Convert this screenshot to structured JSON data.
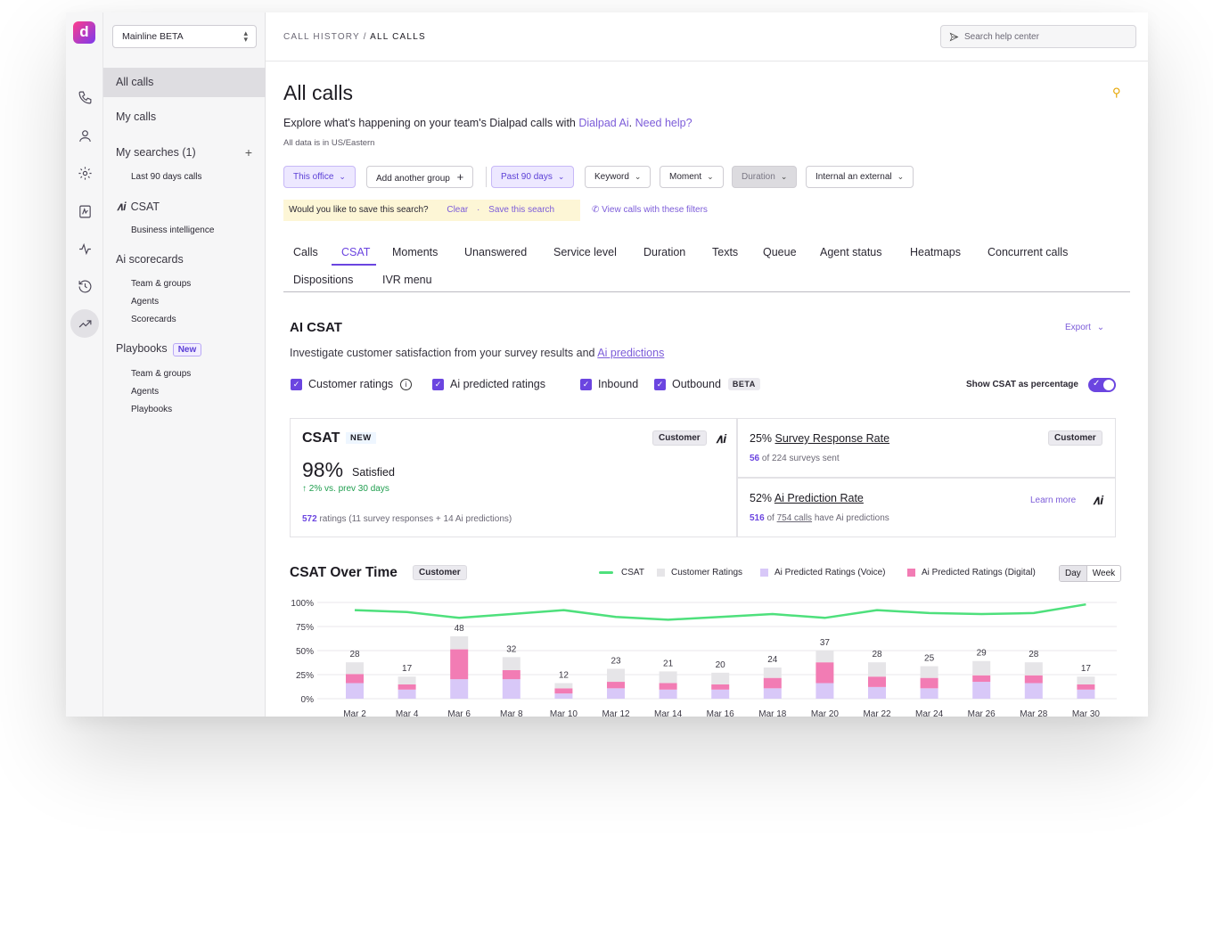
{
  "sidebar": {
    "workspace": "Mainline BETA",
    "all_calls": "All calls",
    "my_calls": "My calls",
    "my_searches": "My searches (1)",
    "plus": "+",
    "last_90": "Last 90 days calls",
    "csat": "CSAT",
    "bi": "Business intelligence",
    "ai_scorecards": "Ai scorecards",
    "sc_team": "Team & groups",
    "sc_agents": "Agents",
    "sc_scorecards": "Scorecards",
    "playbooks": "Playbooks",
    "new_badge": "New",
    "pb_team": "Team & groups",
    "pb_agents": "Agents",
    "pb_playbooks": "Playbooks"
  },
  "topbar": {
    "crumb_parent": "CALL HISTORY",
    "crumb_sep": "/",
    "crumb_current": "ALL CALLS",
    "help_placeholder": "Search help center"
  },
  "header": {
    "title": "All calls",
    "subtitle_pre": "Explore what's happening on your team's Dialpad calls with ",
    "dialpad_ai": "Dialpad Ai",
    "dot": ". ",
    "need_help": "Need help?",
    "timezone": "All data is in US/Eastern"
  },
  "filters": {
    "office": "This office",
    "add_group": "Add another group",
    "add_plus": "+",
    "date": "Past 90 days",
    "keyword": "Keyword",
    "moment": "Moment",
    "duration": "Duration",
    "direction": "Internal an external"
  },
  "save_bar": {
    "question": "Would you like to save this search?",
    "clear": "Clear",
    "dot": "·",
    "save": "Save this search",
    "view_calls": "View calls with these filters"
  },
  "tabs": [
    "Calls",
    "CSAT",
    "Moments",
    "Unanswered",
    "Service level",
    "Duration",
    "Texts",
    "Queue",
    "Agent status",
    "Heatmaps",
    "Concurrent calls",
    "Dispositions",
    "IVR menu"
  ],
  "section": {
    "title": "AI CSAT",
    "export": "Export",
    "desc_pre": "Investigate customer satisfaction from your survey results and ",
    "desc_link": "Ai predictions",
    "cb_customer": "Customer ratings",
    "cb_ai": "Ai predicted ratings",
    "cb_inbound": "Inbound",
    "cb_outbound": "Outbound",
    "beta": "BETA",
    "toggle_label": "Show CSAT as percentage",
    "toggle_on": true
  },
  "csat_card": {
    "title": "CSAT",
    "new": "NEW",
    "customer": "Customer",
    "value": "98%",
    "satisfied": "Satisfied",
    "delta": "↑ 2% vs. prev 30 days",
    "ratings_count": "572",
    "ratings_text": "ratings (11 survey responses + 14 Ai predictions)"
  },
  "survey_card": {
    "pct": "25%",
    "label": "Survey Response Rate",
    "customer": "Customer",
    "count": "56",
    "detail": "of 224 surveys sent"
  },
  "prediction_card": {
    "pct": "52%",
    "label": "Ai Prediction Rate",
    "learn_more": "Learn more",
    "count": "516",
    "of": "of",
    "calls_link": "754 calls",
    "detail": "have Ai predictions"
  },
  "chart_panel": {
    "title": "CSAT Over Time",
    "customer": "Customer",
    "day": "Day",
    "week": "Week"
  },
  "colors": {
    "csat_line": "#4ee07c",
    "customer": "#e6e5e8",
    "ai_voice": "#d8c8f8",
    "ai_digital": "#f27cb4",
    "accent": "#6b45e0"
  },
  "chart_data": {
    "type": "bar",
    "title": "CSAT Over Time",
    "categories": [
      "Mar 2",
      "Mar 4",
      "Mar 6",
      "Mar 8",
      "Mar 10",
      "Mar 12",
      "Mar 14",
      "Mar 16",
      "Mar 18",
      "Mar 20",
      "Mar 22",
      "Mar 24",
      "Mar 26",
      "Mar 28",
      "Mar 30"
    ],
    "totals": [
      28,
      17,
      48,
      32,
      12,
      23,
      21,
      20,
      24,
      37,
      28,
      25,
      29,
      28,
      17
    ],
    "series": [
      {
        "name": "Customer Ratings",
        "values": [
          9,
          6,
          10,
          10,
          4,
          10,
          9,
          9,
          8,
          9,
          11,
          9,
          11,
          10,
          6
        ]
      },
      {
        "name": "Ai Predicted Ratings (Voice)",
        "values": [
          12,
          7,
          15,
          15,
          4,
          8,
          7,
          7,
          8,
          12,
          9,
          8,
          13,
          12,
          7
        ]
      },
      {
        "name": "Ai Predicted Ratings (Digital)",
        "values": [
          7,
          4,
          23,
          7,
          4,
          5,
          5,
          4,
          8,
          16,
          8,
          8,
          5,
          6,
          4
        ]
      },
      {
        "name": "CSAT",
        "type": "line",
        "values": [
          92,
          90,
          84,
          88,
          92,
          85,
          82,
          85,
          88,
          84,
          92,
          89,
          88,
          89,
          98
        ]
      }
    ],
    "y_ticks": [
      "100%",
      "75%",
      "50%",
      "25%",
      "0%"
    ],
    "ylim": [
      0,
      100
    ],
    "grid": true,
    "legend": "top-right"
  }
}
